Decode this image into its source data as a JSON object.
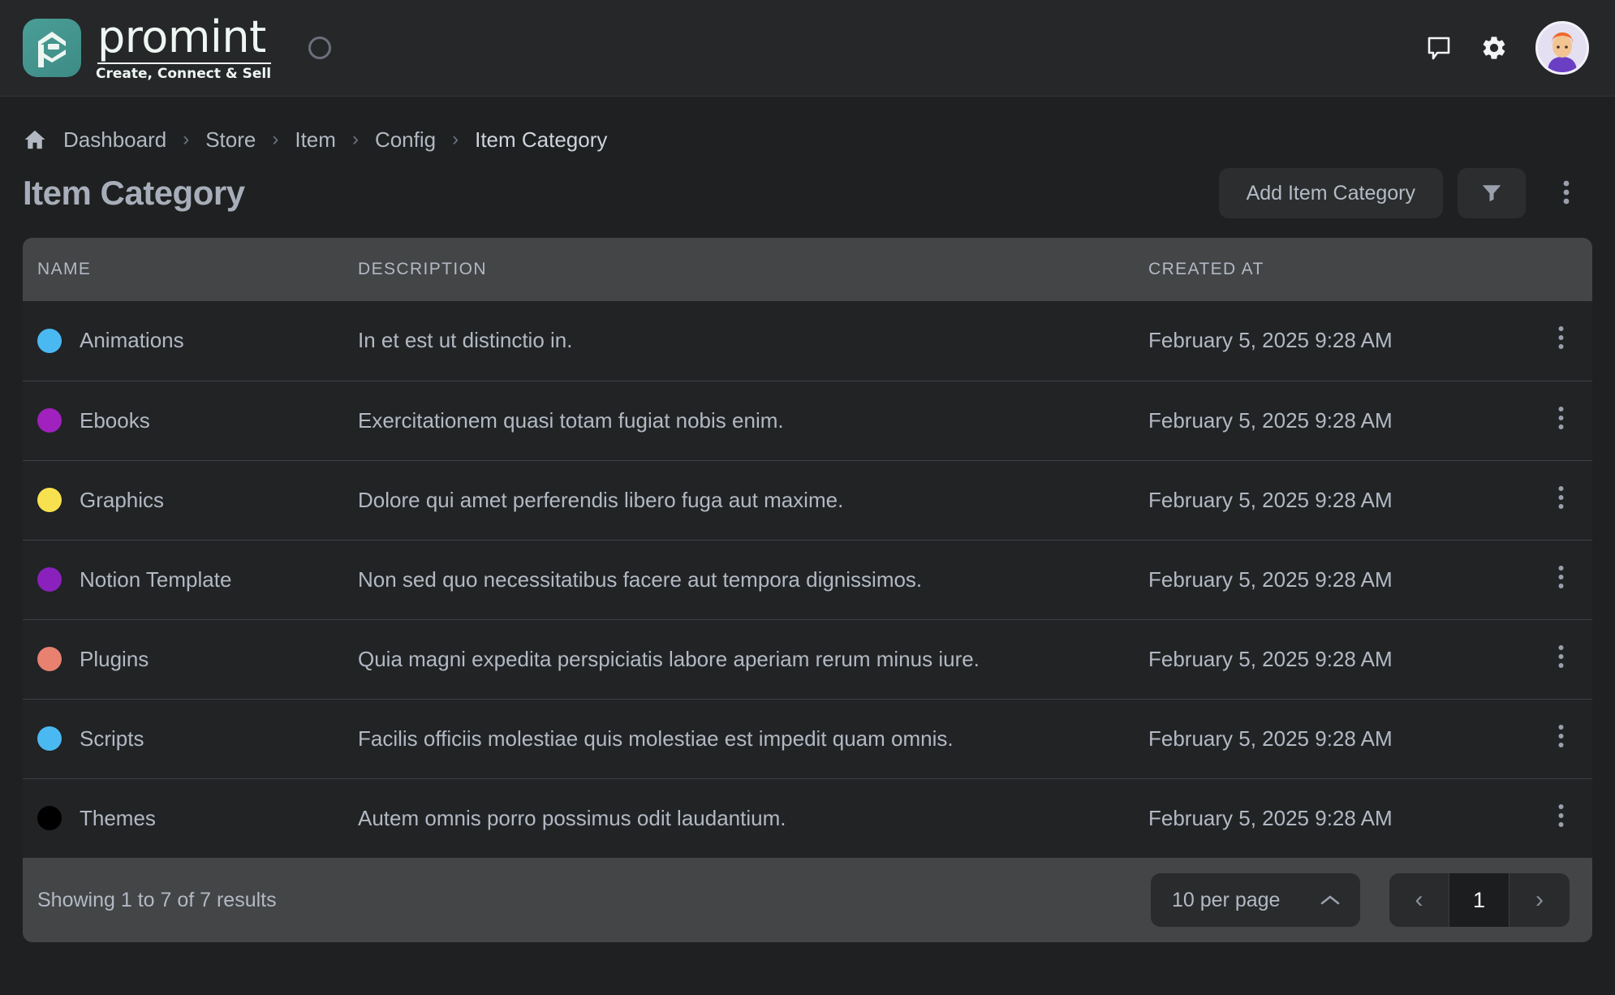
{
  "topbar": {
    "logo_word": "promint",
    "logo_tagline": "Create, Connect & Sell",
    "icons": {
      "spinner": "loading-spinner",
      "chat": "chat-bubble-icon",
      "settings": "gear-icon",
      "avatar": "user-avatar"
    }
  },
  "breadcrumb": {
    "home_icon": "home-icon",
    "separator": "›",
    "items": [
      {
        "label": "Dashboard"
      },
      {
        "label": "Store"
      },
      {
        "label": "Item"
      },
      {
        "label": "Config"
      },
      {
        "label": "Item Category"
      }
    ]
  },
  "page": {
    "title": "Item Category",
    "add_button": "Add Item Category",
    "filter_icon": "filter-funnel-icon",
    "more_icon": "more-vertical-icon"
  },
  "table": {
    "columns": [
      "NAME",
      "DESCRIPTION",
      "CREATED AT"
    ],
    "rows": [
      {
        "color": "#4ab9f2",
        "name": "Animations",
        "description": "In et est ut distinctio in.",
        "created_at": "February 5, 2025 9:28 AM"
      },
      {
        "color": "#a021bd",
        "name": "Ebooks",
        "description": "Exercitationem quasi totam fugiat nobis enim.",
        "created_at": "February 5, 2025 9:28 AM"
      },
      {
        "color": "#f7e14f",
        "name": "Graphics",
        "description": "Dolore qui amet perferendis libero fuga aut maxime.",
        "created_at": "February 5, 2025 9:28 AM"
      },
      {
        "color": "#8a21bd",
        "name": "Notion Template",
        "description": "Non sed quo necessitatibus facere aut tempora dignissimos.",
        "created_at": "February 5, 2025 9:28 AM"
      },
      {
        "color": "#e8816f",
        "name": "Plugins",
        "description": "Quia magni expedita perspiciatis labore aperiam rerum minus iure.",
        "created_at": "February 5, 2025 9:28 AM"
      },
      {
        "color": "#4ab9f2",
        "name": "Scripts",
        "description": "Facilis officiis molestiae quis molestiae est impedit quam omnis.",
        "created_at": "February 5, 2025 9:28 AM"
      },
      {
        "color": "#000000",
        "name": "Themes",
        "description": "Autem omnis porro possimus odit laudantium.",
        "created_at": "February 5, 2025 9:28 AM"
      }
    ],
    "row_menu_icon": "more-vertical-icon"
  },
  "footer": {
    "showing": "Showing 1 to 7 of 7 results",
    "per_page": "10 per page",
    "per_page_chevron": "chevron-up-icon",
    "prev": "‹",
    "page": "1",
    "next": "›"
  },
  "theme": {
    "bg": "#1e2021",
    "topbar_bg": "#252729",
    "row_bg": "#212325",
    "header_bg": "#434547",
    "text": "#b3b9c3",
    "brand_teal": "#4a9e96"
  }
}
